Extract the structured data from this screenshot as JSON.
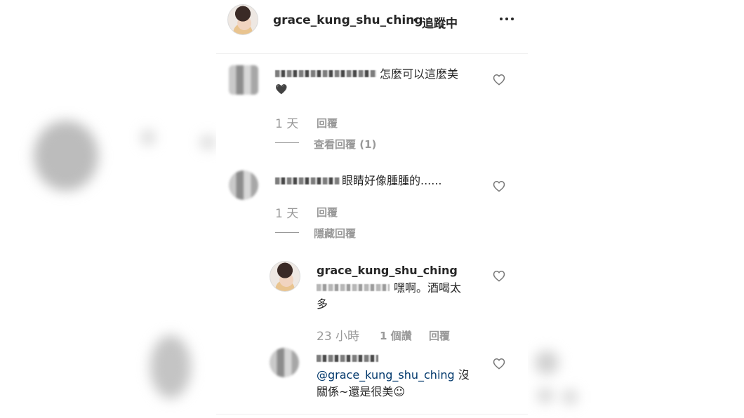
{
  "header": {
    "username": "grace_kung_shu_ching",
    "separator": "•",
    "follow_status": "追蹤中"
  },
  "comments": [
    {
      "text": "怎麼可以這麼美",
      "emoji": "🖤",
      "time": "1 天",
      "reply": "回覆",
      "view_replies": "查看回覆 (1)"
    },
    {
      "text": "眼睛好像腫腫的......",
      "time": "1 天",
      "reply": "回覆",
      "hide_replies": "隱藏回覆"
    }
  ],
  "replies": [
    {
      "username": "grace_kung_shu_ching",
      "text_line1": "嘿啊。酒喝太",
      "text_line2": "多",
      "time": "23 小時",
      "likes": "1 個讚",
      "reply": "回覆"
    },
    {
      "mention": "@grace_kung_shu_ching",
      "text_tail": "沒",
      "text_line2": "關係~還是很美☺"
    }
  ],
  "icons": {
    "more": "more-horizontal-icon",
    "like": "heart-outline-icon"
  }
}
